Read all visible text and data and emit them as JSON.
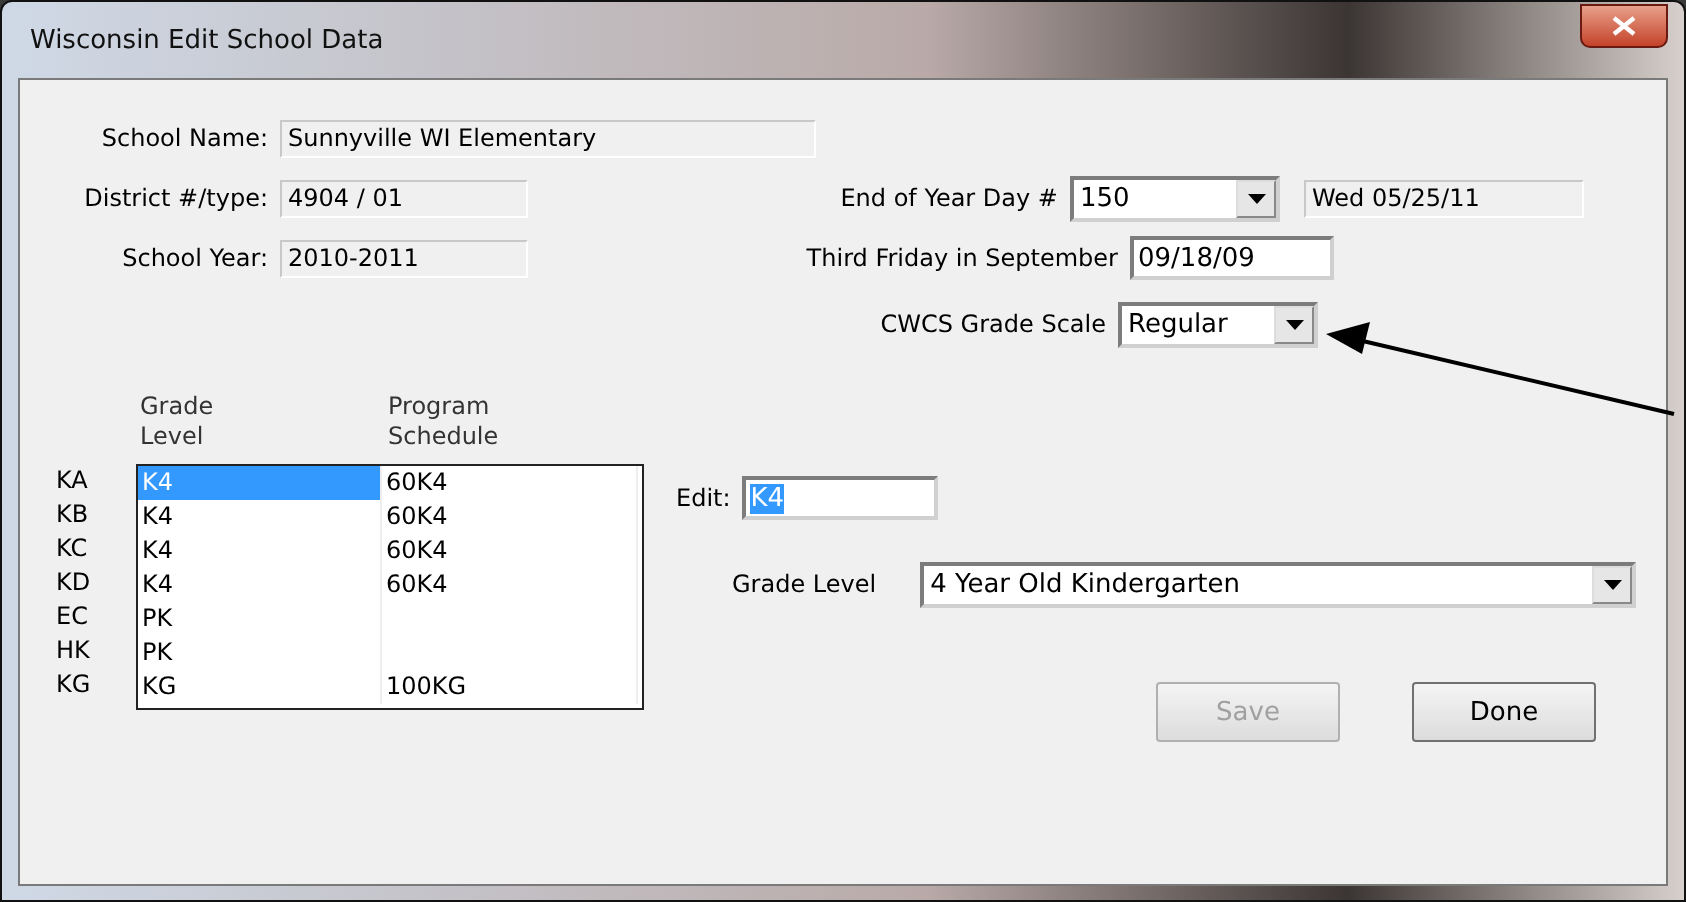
{
  "window": {
    "title": "Wisconsin Edit School Data"
  },
  "school_name": {
    "label": "School Name:",
    "value": "Sunnyville WI Elementary"
  },
  "district": {
    "label": "District #/type:",
    "value": "4904 / 01"
  },
  "school_year": {
    "label": "School Year:",
    "value": "2010-2011"
  },
  "end_of_year": {
    "label": "End of Year Day #",
    "value": "150",
    "date": "Wed 05/25/11"
  },
  "third_friday": {
    "label": "Third Friday in September",
    "value": "09/18/09"
  },
  "grade_scale": {
    "label": "CWCS Grade Scale",
    "value": "Regular"
  },
  "table": {
    "columns": [
      "Grade\nLevel",
      "Program\nSchedule"
    ],
    "rows": [
      {
        "code": "KA",
        "grade": "K4",
        "schedule": "60K4",
        "selected": true
      },
      {
        "code": "KB",
        "grade": "K4",
        "schedule": "60K4",
        "selected": false
      },
      {
        "code": "KC",
        "grade": "K4",
        "schedule": "60K4",
        "selected": false
      },
      {
        "code": "KD",
        "grade": "K4",
        "schedule": "60K4",
        "selected": false
      },
      {
        "code": "EC",
        "grade": "PK",
        "schedule": "",
        "selected": false
      },
      {
        "code": "HK",
        "grade": "PK",
        "schedule": "",
        "selected": false
      },
      {
        "code": "KG",
        "grade": "KG",
        "schedule": "100KG",
        "selected": false
      }
    ]
  },
  "edit": {
    "label": "Edit:",
    "value": "K4"
  },
  "grade_level": {
    "label": "Grade Level",
    "value": "4 Year Old Kindergarten"
  },
  "buttons": [
    {
      "label": "Save",
      "disabled": true
    },
    {
      "label": "Done",
      "disabled": false
    }
  ]
}
